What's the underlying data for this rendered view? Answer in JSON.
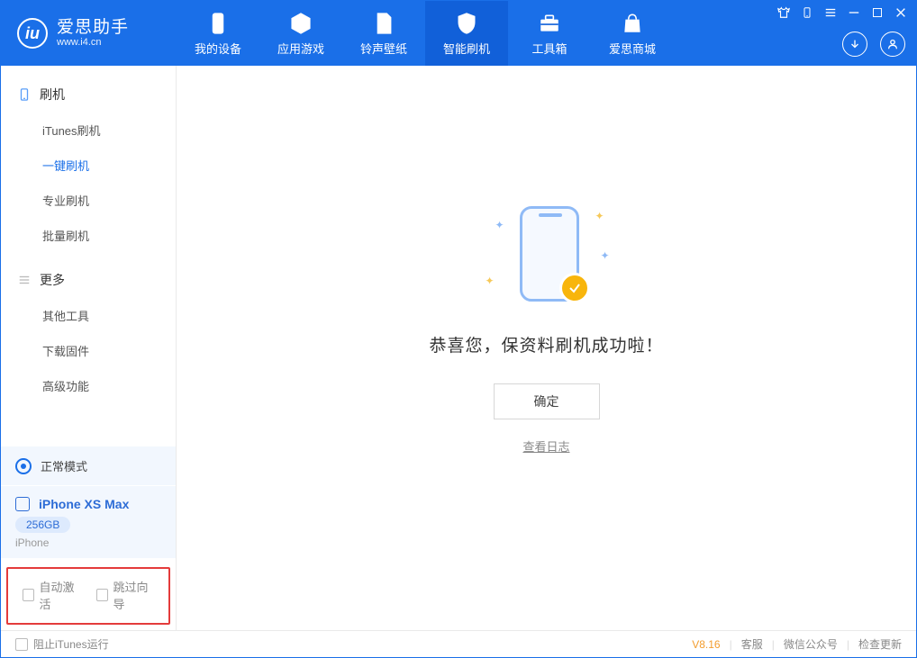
{
  "app": {
    "title": "爱思助手",
    "site": "www.i4.cn"
  },
  "header_tabs": [
    {
      "label": "我的设备"
    },
    {
      "label": "应用游戏"
    },
    {
      "label": "铃声壁纸"
    },
    {
      "label": "智能刷机"
    },
    {
      "label": "工具箱"
    },
    {
      "label": "爱思商城"
    }
  ],
  "sidebar": {
    "section1": {
      "title": "刷机"
    },
    "items1": [
      {
        "label": "iTunes刷机"
      },
      {
        "label": "一键刷机"
      },
      {
        "label": "专业刷机"
      },
      {
        "label": "批量刷机"
      }
    ],
    "section2": {
      "title": "更多"
    },
    "items2": [
      {
        "label": "其他工具"
      },
      {
        "label": "下载固件"
      },
      {
        "label": "高级功能"
      }
    ]
  },
  "status_panel": {
    "mode": "正常模式"
  },
  "device": {
    "name": "iPhone XS Max",
    "capacity": "256GB",
    "type": "iPhone"
  },
  "options": {
    "opt1": "自动激活",
    "opt2": "跳过向导"
  },
  "main": {
    "message": "恭喜您，保资料刷机成功啦！",
    "confirm": "确定",
    "view_log": "查看日志"
  },
  "footer": {
    "block_itunes": "阻止iTunes运行",
    "version": "V8.16",
    "link1": "客服",
    "link2": "微信公众号",
    "link3": "检查更新"
  }
}
